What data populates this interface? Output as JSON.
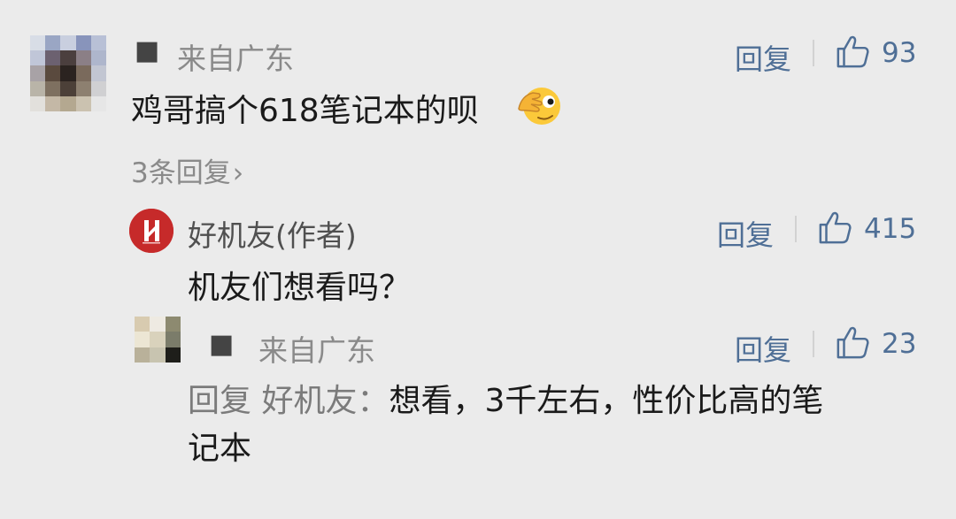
{
  "comments": [
    {
      "username": "来自广东",
      "text": "鸡哥搞个618笔记本的呗",
      "emoji": "face-with-hand-over-eye-emoji",
      "reply_button": "回复",
      "likes": "93",
      "more_replies": "3条回复",
      "more_replies_arrow": "›"
    },
    {
      "username": "好机友(作者)",
      "text": "机友们想看吗？",
      "reply_button": "回复",
      "likes": "415"
    },
    {
      "username": "来自广东",
      "reply_prefix": "回复",
      "reply_target": "好机友：",
      "text_line1": "想看，3千左右，性价比高的笔",
      "text_line2": "记本",
      "reply_button": "回复",
      "likes": "23"
    }
  ],
  "name_mark_1": "■",
  "name_mark_2": "■",
  "colors": {
    "background": "#ebebeb",
    "accent": "#4f6f96",
    "author_brand": "#c62a2a",
    "muted_text": "#8a8a8a",
    "primary_text": "#1a1a1a"
  }
}
